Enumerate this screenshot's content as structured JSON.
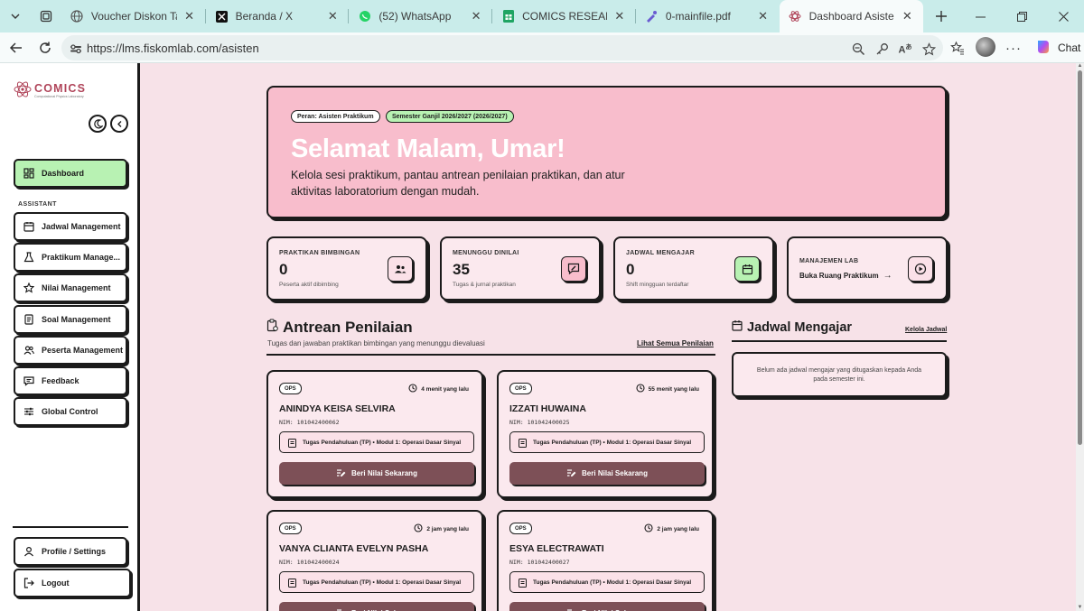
{
  "browser": {
    "tabs": [
      {
        "title": "Voucher Diskon Tanpa",
        "icon": "globe-icon"
      },
      {
        "title": "Beranda / X",
        "icon": "x-icon"
      },
      {
        "title": "(52) WhatsApp",
        "icon": "whatsapp-icon"
      },
      {
        "title": "COMICS RESEARCH.ex",
        "icon": "sheets-icon"
      },
      {
        "title": "0-mainfile.pdf",
        "icon": "pdf-icon"
      },
      {
        "title": "Dashboard Asisten - LI",
        "icon": "comics-icon"
      }
    ],
    "url": "https://lms.fiskomlab.com/asisten",
    "chat_label": "Chat"
  },
  "sidebar": {
    "logo_text": "COMICS",
    "logo_sub": "Computational Physics Laboratory",
    "dashboard": "Dashboard",
    "section": "ASSISTANT",
    "items": [
      {
        "label": "Jadwal Management",
        "icon": "calendar-icon"
      },
      {
        "label": "Praktikum Manage...",
        "icon": "flask-icon"
      },
      {
        "label": "Nilai Management",
        "icon": "star-icon"
      },
      {
        "label": "Soal Management",
        "icon": "document-icon"
      },
      {
        "label": "Peserta Management",
        "icon": "users-icon"
      },
      {
        "label": "Feedback",
        "icon": "chat-icon"
      },
      {
        "label": "Global Control",
        "icon": "sliders-icon"
      }
    ],
    "profile": "Profile / Settings",
    "logout": "Logout"
  },
  "hero": {
    "role_chip": "Peran: Asisten Praktikum",
    "semester_chip": "Semester Ganjil 2026/2027 (2026/2027)",
    "greeting": "Selamat Malam, Umar!",
    "description": "Kelola sesi praktikum, pantau antrean penilaian praktikan, dan atur aktivitas laboratorium dengan mudah."
  },
  "stats": [
    {
      "label": "PRAKTIKAN BIMBINGAN",
      "value": "0",
      "sub": "Peserta aktif dibimbing",
      "icon": "users-icon",
      "color": "#fbe1e8"
    },
    {
      "label": "MENUNGGU DINILAI",
      "value": "35",
      "sub": "Tugas & jurnal praktikan",
      "icon": "edit-icon",
      "color": "#f8bdcc"
    },
    {
      "label": "JADWAL MENGAJAR",
      "value": "0",
      "sub": "Shift mingguan terdaftar",
      "icon": "calendar-icon",
      "color": "#b8f2b3"
    },
    {
      "label": "MANAJEMEN LAB",
      "link": "Buka Ruang Praktikum",
      "icon": "play-icon",
      "color": "#fbe1e8"
    }
  ],
  "queue": {
    "title": "Antrean Penilaian",
    "subtitle": "Tugas dan jawaban praktikan bimbingan yang menunggu dievaluasi",
    "link": "Lihat Semua Penilaian",
    "button_label": "Beri Nilai Sekarang",
    "items": [
      {
        "tag": "OPS",
        "time": "4 menit yang lalu",
        "name": "ANINDYA KEISA SELVIRA",
        "nim": "NIM: 101042400062",
        "task": "Tugas Pendahuluan (TP) • Modul 1: Operasi Dasar Sinyal"
      },
      {
        "tag": "OPS",
        "time": "55 menit yang lalu",
        "name": "IZZATI HUWAINA",
        "nim": "NIM: 101042400025",
        "task": "Tugas Pendahuluan (TP) • Modul 1: Operasi Dasar Sinyal"
      },
      {
        "tag": "OPS",
        "time": "2 jam yang lalu",
        "name": "VANYA CLIANTA EVELYN PASHA",
        "nim": "NIM: 101042400024",
        "task": "Tugas Pendahuluan (TP) • Modul 1: Operasi Dasar Sinyal"
      },
      {
        "tag": "OPS",
        "time": "2 jam yang lalu",
        "name": "ESYA ELECTRAWATI",
        "nim": "NIM: 101042400027",
        "task": "Tugas Pendahuluan (TP) • Modul 1: Operasi Dasar Sinyal"
      }
    ]
  },
  "schedule": {
    "title": "Jadwal Mengajar",
    "link": "Kelola Jadwal",
    "empty": "Belum ada jadwal mengajar yang ditugaskan kepada Anda pada semester ini."
  },
  "colors": {
    "accent_green": "#b8f2b3",
    "hero_pink": "#f8bdcc",
    "button_maroon": "#7d5057",
    "tabbar": "#c9ecea"
  }
}
